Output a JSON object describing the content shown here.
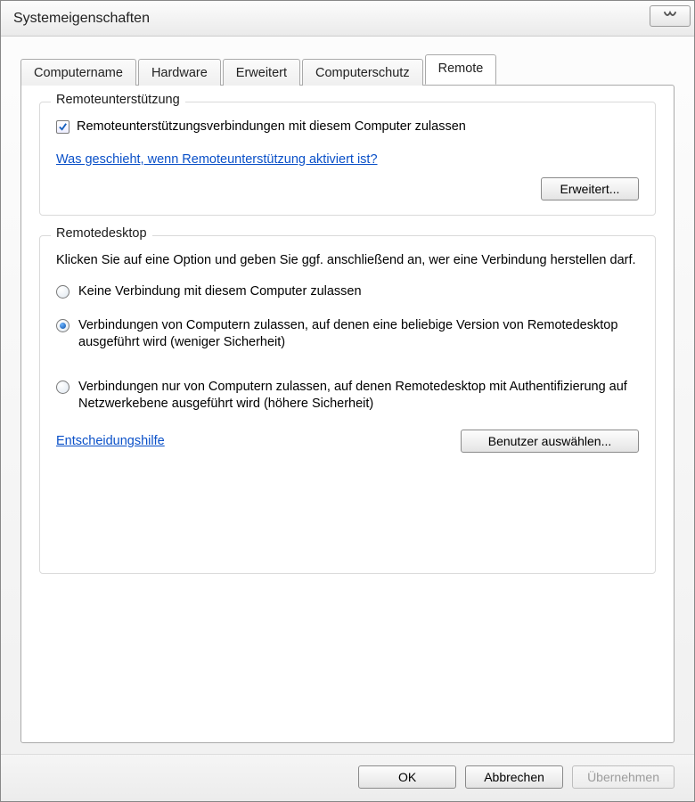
{
  "title": "Systemeigenschaften",
  "tabs": {
    "computername": "Computername",
    "hardware": "Hardware",
    "erweitert": "Erweitert",
    "computerschutz": "Computerschutz",
    "remote": "Remote"
  },
  "remote_assist": {
    "legend": "Remoteunterstützung",
    "checkbox_label": "Remoteunterstützungsverbindungen mit diesem Computer zulassen",
    "info_link": "Was geschieht, wenn Remoteunterstützung aktiviert ist?",
    "advanced_button": "Erweitert..."
  },
  "remote_desktop": {
    "legend": "Remotedesktop",
    "instruction": "Klicken Sie auf eine Option und geben Sie ggf. anschließend an, wer eine Verbindung herstellen darf.",
    "option_none": "Keine Verbindung mit diesem Computer zulassen",
    "option_any": "Verbindungen von Computern zulassen, auf denen eine beliebige Version von Remotedesktop ausgeführt wird (weniger Sicherheit)",
    "option_nla": "Verbindungen nur von Computern zulassen, auf denen Remotedesktop mit Authentifizierung auf Netzwerkebene ausgeführt wird (höhere Sicherheit)",
    "help_link": "Entscheidungshilfe",
    "select_users_button": "Benutzer auswählen..."
  },
  "buttons": {
    "ok": "OK",
    "cancel": "Abbrechen",
    "apply": "Übernehmen"
  }
}
